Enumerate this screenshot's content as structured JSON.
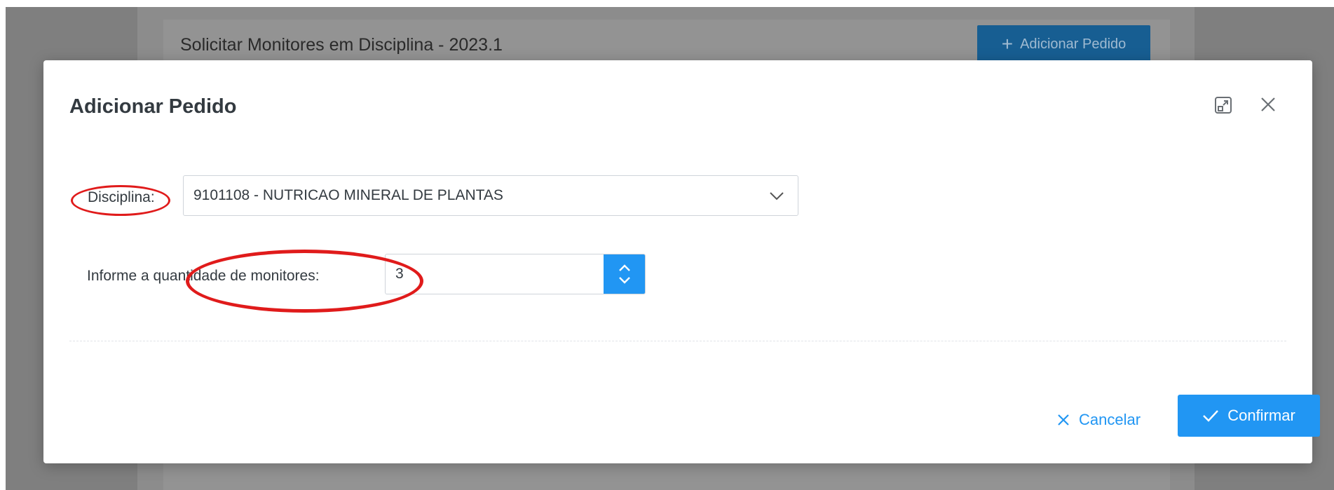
{
  "background": {
    "page_title": "Solicitar Monitores em Disciplina - 2023.1",
    "add_button_label": "Adicionar Pedido",
    "add_button_icon": "plus-icon"
  },
  "modal": {
    "title": "Adicionar Pedido",
    "icons": [
      "maximize-icon",
      "close-icon"
    ],
    "disciplina_label": "Disciplina:",
    "disciplina_value": "9101108 - NUTRICAO MINERAL DE PLANTAS",
    "quantidade_label": "Informe a quantidade de monitores:",
    "quantidade_value": "3",
    "cancel_label": "Cancelar",
    "confirm_label": "Confirmar"
  },
  "colors": {
    "accent": "#2196f3",
    "annotation": "#e01b1b",
    "overlay": "#7f7f7f"
  }
}
